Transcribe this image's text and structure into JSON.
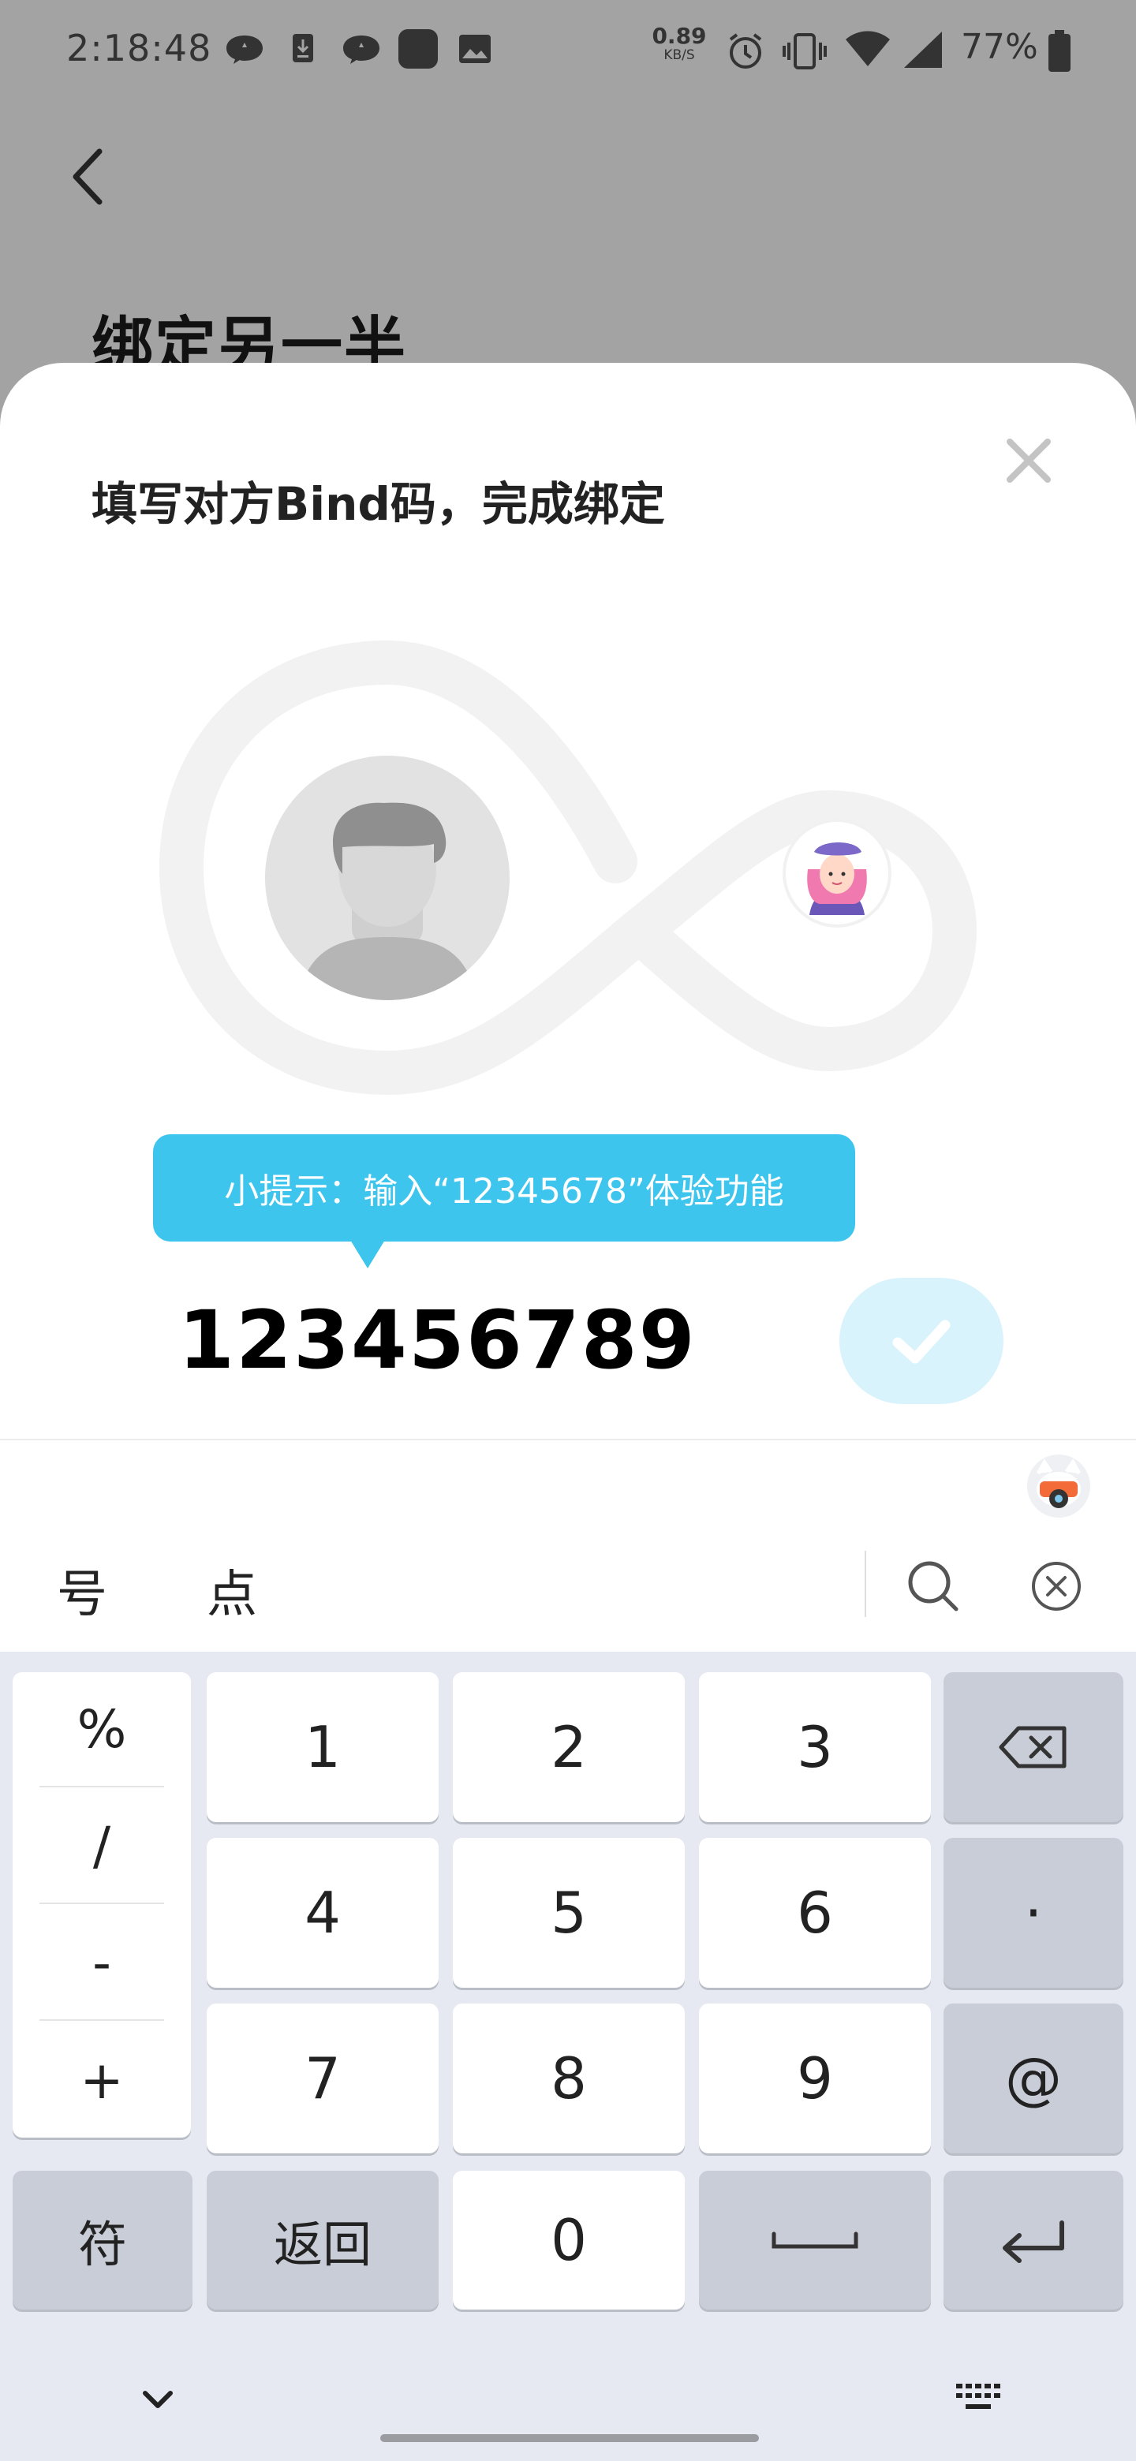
{
  "status_bar": {
    "time": "2:18:48",
    "net_speed": "0.89",
    "net_unit": "KB/S",
    "battery": "77%",
    "icons": [
      "chat-icon",
      "download-icon",
      "chat-icon",
      "app-icon",
      "image-icon",
      "alarm-icon",
      "vibrate-icon",
      "wifi-icon",
      "signal-icon",
      "battery-icon"
    ]
  },
  "page": {
    "title": "绑定另一半"
  },
  "sheet": {
    "title": "填写对方Bind码，完成绑定",
    "tip": "小提示：输入“12345678”体验功能",
    "code_value": "123456789"
  },
  "keyboard": {
    "candidates": [
      "号",
      "点"
    ],
    "symbols": [
      "%",
      "/",
      "-",
      "+"
    ],
    "digits": [
      "1",
      "2",
      "3",
      "4",
      "5",
      "6",
      "7",
      "8",
      "9",
      "0"
    ],
    "dot_key": "·",
    "at_key": "@",
    "symbol_key": "符",
    "back_key": "返回"
  },
  "colors": {
    "accent": "#3ec5ee",
    "confirm_bg": "#d8f3fc",
    "overlay": "#a3a3a3",
    "keyboard_bg": "#e6e9f1",
    "function_key": "#c9cdd7"
  }
}
